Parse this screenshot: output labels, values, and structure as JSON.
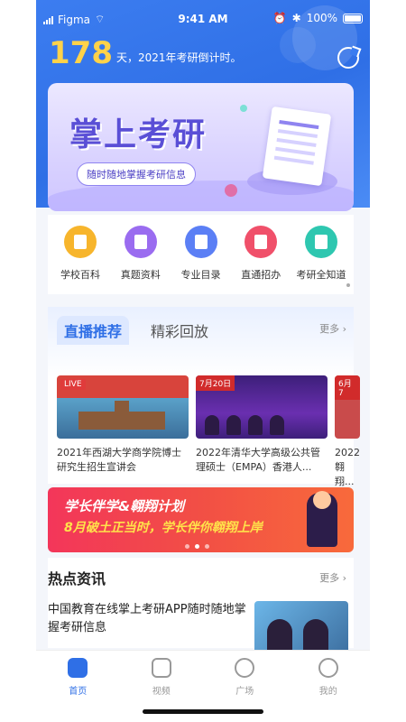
{
  "status": {
    "carrier": "Figma",
    "time": "9:41 AM",
    "battery": "100%"
  },
  "countdown": {
    "days": "178",
    "text": "天，2021年考研倒计时。"
  },
  "banner": {
    "title": "掌上考研",
    "subtitle": "随时随地掌握考研信息"
  },
  "categories": [
    {
      "label": "学校百科",
      "color": "#f7b52c"
    },
    {
      "label": "真题资料",
      "color": "#9a6cf0"
    },
    {
      "label": "专业目录",
      "color": "#5b7ff5"
    },
    {
      "label": "直通招办",
      "color": "#f0506a"
    },
    {
      "label": "考研全知道",
      "color": "#2ec7b0"
    }
  ],
  "live": {
    "tab_active": "直播推荐",
    "tab_other": "精彩回放",
    "more": "更多",
    "cards": [
      {
        "badge": "LIVE",
        "caption": "2021年西湖大学商学院博士研究生招生宣讲会"
      },
      {
        "badge": "7月20日",
        "caption": "2022年清华大学高级公共管理硕士（EMPA）香港人..."
      },
      {
        "badge": "6月7",
        "caption": "2022... 翱翔..."
      }
    ]
  },
  "promo": {
    "line1": "学长伴学&翱翔计划",
    "line2": "8月破土正当时，学长伴你翱翔上岸"
  },
  "news": {
    "title": "热点资讯",
    "more": "更多",
    "item": "中国教育在线掌上考研APP随时随地掌握考研信息"
  },
  "tabbar": [
    {
      "label": "首页",
      "active": true
    },
    {
      "label": "视频",
      "active": false
    },
    {
      "label": "广场",
      "active": false
    },
    {
      "label": "我的",
      "active": false
    }
  ],
  "colors": {
    "primary": "#2f6fe6",
    "accent": "#ffd24a"
  }
}
